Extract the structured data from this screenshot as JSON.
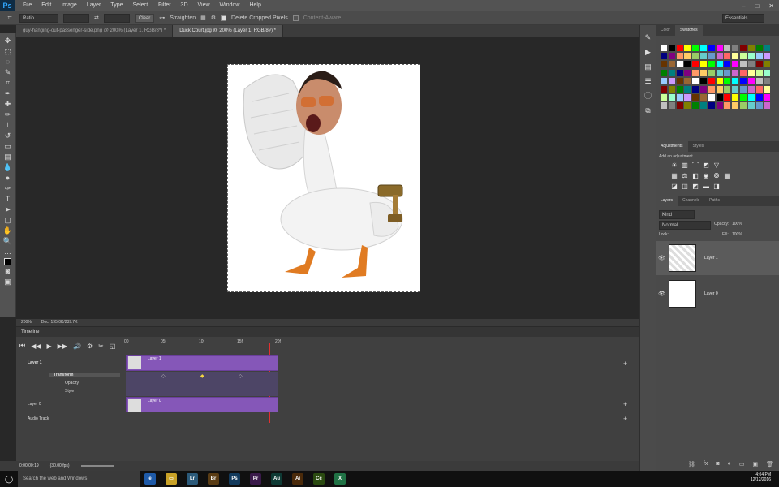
{
  "app": {
    "logo": "Ps"
  },
  "menu": [
    "File",
    "Edit",
    "Image",
    "Layer",
    "Type",
    "Select",
    "Filter",
    "3D",
    "View",
    "Window",
    "Help"
  ],
  "options": {
    "ratio": "Ratio",
    "clear": "Clear",
    "straighten": "Straighten",
    "delete_cropped": "Delete Cropped Pixels",
    "content_aware": "Content-Aware",
    "workspace": "Essentials"
  },
  "tabs": [
    {
      "label": "guy-hanging-out-passenger-side.png @ 200% (Layer 1, RGB/8*) *"
    },
    {
      "label": "Duck Court.jpg @ 200% (Layer 1, RGB/8#) *"
    }
  ],
  "status": {
    "zoom": "200%",
    "doc": "Doc: 195.0K/239.7K"
  },
  "timeline": {
    "title": "Timeline",
    "ruler": [
      "00",
      "05f",
      "10f",
      "15f",
      "20f"
    ],
    "tracks": {
      "layer1": "Layer 1",
      "transform": "Transform",
      "opacity": "Opacity",
      "style": "Style",
      "layer0": "Layer 0",
      "audio": "Audio Track"
    },
    "clips": {
      "layer1": "Layer 1",
      "layer0": "Layer 0"
    },
    "time": "0:00:00:19",
    "fps": "(30.00 fps)"
  },
  "color_panel": {
    "tabs": [
      "Color",
      "Swatches"
    ],
    "swatch_colors": [
      "#ffffff",
      "#000000",
      "#ff0000",
      "#ffff00",
      "#00ff00",
      "#00ffff",
      "#0000ff",
      "#ff00ff",
      "#c0c0c0",
      "#808080",
      "#800000",
      "#808000",
      "#008000",
      "#008080",
      "#000080",
      "#800080",
      "#ff9966",
      "#ffcc66",
      "#99cc66",
      "#66cccc",
      "#6699cc",
      "#cc66cc",
      "#ff6666",
      "#ffff99",
      "#ccff99",
      "#99ffcc",
      "#99ccff",
      "#cc99ff",
      "#663300",
      "#996633"
    ]
  },
  "adjustments": {
    "tabs": [
      "Adjustments",
      "Styles"
    ],
    "hint": "Add an adjustment"
  },
  "layers_panel": {
    "tabs": [
      "Layers",
      "Channels",
      "Paths"
    ],
    "kind": "Kind",
    "blend": "Normal",
    "opacity_label": "Opacity:",
    "opacity": "100%",
    "lock_label": "Lock:",
    "fill_label": "Fill:",
    "fill": "100%",
    "layers": [
      {
        "name": "Layer 1"
      },
      {
        "name": "Layer 0"
      }
    ]
  },
  "taskbar": {
    "search": "Search the web and Windows",
    "time": "4:04 PM",
    "date": "12/12/2016",
    "apps": [
      {
        "label": "Lr",
        "color": "#2b5a7a"
      },
      {
        "label": "Br",
        "color": "#5a3c14"
      },
      {
        "label": "Ps",
        "color": "#123a5c"
      },
      {
        "label": "Pr",
        "color": "#3a1a4a"
      },
      {
        "label": "Au",
        "color": "#0e3a34"
      },
      {
        "label": "Ai",
        "color": "#4a2a0a"
      },
      {
        "label": "Cc",
        "color": "#2a4a10"
      },
      {
        "label": "X",
        "color": "#207245"
      }
    ]
  }
}
